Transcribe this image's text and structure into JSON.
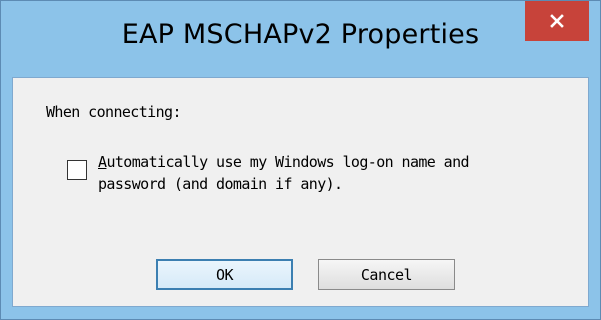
{
  "window": {
    "title": "EAP MSCHAPv2 Properties",
    "close_icon": "close-icon"
  },
  "content": {
    "when_connecting_label": "When connecting:",
    "auto_logon": {
      "checked": false,
      "mnemonic": "A",
      "line1_rest": "utomatically use my Windows log-on name and",
      "line2": "password (and domain if any)."
    }
  },
  "buttons": {
    "ok_label": "OK",
    "cancel_label": "Cancel"
  },
  "colors": {
    "frame": "#8cc3e9",
    "close_button": "#c7433a",
    "client_bg": "#f0f0f0",
    "default_button_border": "#3c7fb1"
  }
}
